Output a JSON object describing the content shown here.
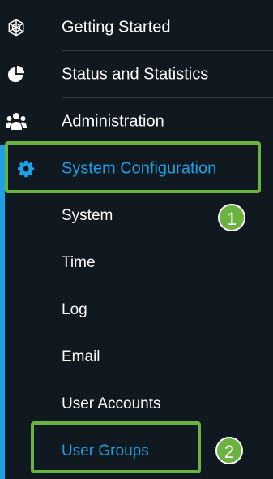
{
  "nav": {
    "items": [
      {
        "label": "Getting Started",
        "icon": "globe-icon"
      },
      {
        "label": "Status and Statistics",
        "icon": "pie-chart-icon"
      },
      {
        "label": "Administration",
        "icon": "users-icon"
      },
      {
        "label": "System Configuration",
        "icon": "gear-icon"
      }
    ],
    "sub_items": [
      {
        "label": "System"
      },
      {
        "label": "Time"
      },
      {
        "label": "Log"
      },
      {
        "label": "Email"
      },
      {
        "label": "User Accounts"
      },
      {
        "label": "User Groups"
      }
    ]
  },
  "annotations": {
    "step1": "1",
    "step2": "2"
  },
  "colors": {
    "background": "#101820",
    "active_text": "#1ea0e6",
    "highlight": "#6ab341"
  }
}
